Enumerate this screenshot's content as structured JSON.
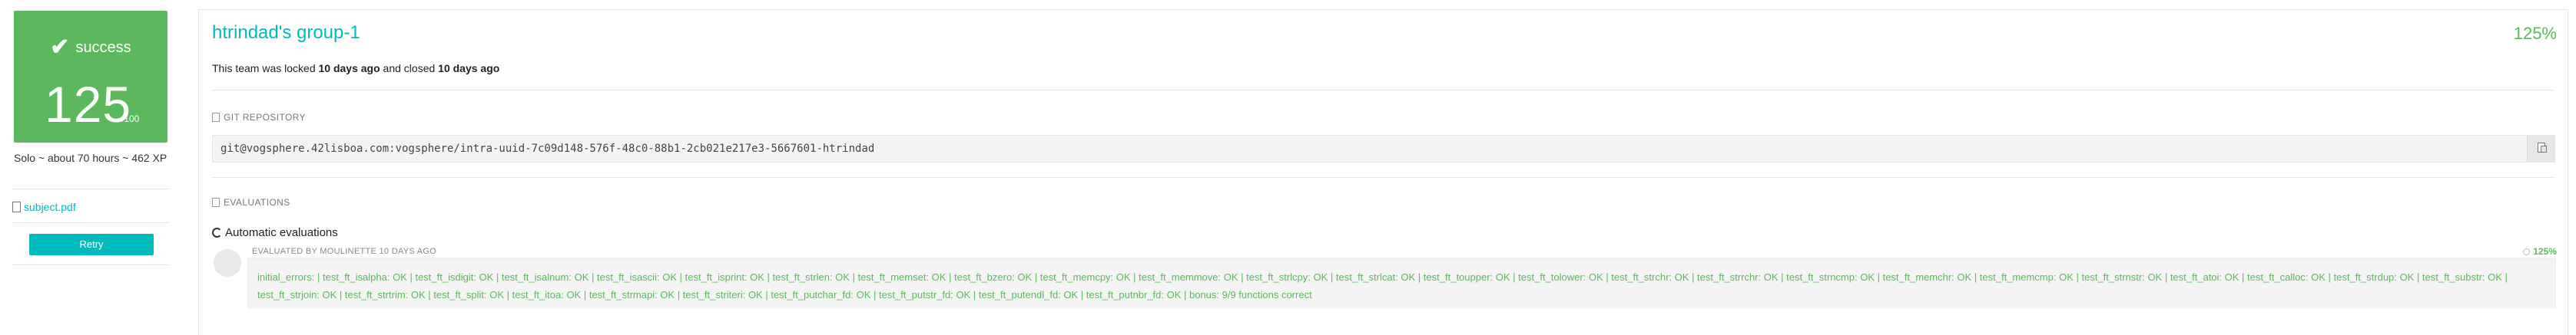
{
  "score_card": {
    "status": "success",
    "score": "125",
    "out_of": "/100",
    "status_color": "#5cb85c",
    "check_icon": "check-icon"
  },
  "team_info": "Solo ~ about 70 hours ~ 462 XP",
  "subject": {
    "label": "subject.pdf",
    "icon": "document-icon"
  },
  "retry_label": "Retry",
  "team": {
    "name": "htrindad's group-1",
    "percent": "125%",
    "lock_prefix": "This team was locked",
    "locked_ago": "10 days ago",
    "closed_word": "and closed",
    "closed_ago": "10 days ago"
  },
  "git": {
    "label": "GIT REPOSITORY",
    "url": "git@vogsphere.42lisboa.com:vogsphere/intra-uuid-7c09d148-576f-48c0-88b1-2cb021e217e3-5667601-htrindad",
    "copy_icon": "copy-icon"
  },
  "evaluations": {
    "label": "EVALUATIONS",
    "auto_label": "Automatic evaluations",
    "evaluated_by": "EVALUATED BY MOULINETTE 10 DAYS AGO",
    "score": "125%",
    "result_text": "initial_errors: | test_ft_isalpha: OK | test_ft_isdigit: OK | test_ft_isalnum: OK | test_ft_isascii: OK | test_ft_isprint: OK | test_ft_strlen: OK | test_ft_memset: OK | test_ft_bzero: OK | test_ft_memcpy: OK | test_ft_memmove: OK | test_ft_strlcpy: OK | test_ft_strlcat: OK | test_ft_toupper: OK | test_ft_tolower: OK | test_ft_strchr: OK | test_ft_strrchr: OK | test_ft_strncmp: OK | test_ft_memchr: OK | test_ft_memcmp: OK | test_ft_strnstr: OK | test_ft_atoi: OK | test_ft_calloc: OK | test_ft_strdup: OK | test_ft_substr: OK | test_ft_strjoin: OK | test_ft_strtrim: OK | test_ft_split: OK | test_ft_itoa: OK | test_ft_strmapi: OK | test_ft_striteri: OK | test_ft_putchar_fd: OK | test_ft_putstr_fd: OK | test_ft_putendl_fd: OK | test_ft_putnbr_fd: OK | bonus: 9/9 functions correct"
  },
  "colors": {
    "accent": "#00babc",
    "success": "#5cb85c"
  }
}
